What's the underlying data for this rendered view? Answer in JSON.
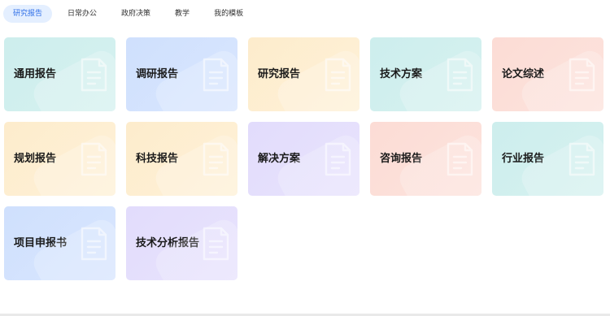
{
  "tabs": [
    {
      "label": "研究报告",
      "active": true
    },
    {
      "label": "日常办公",
      "active": false
    },
    {
      "label": "政府决策",
      "active": false
    },
    {
      "label": "教学",
      "active": false
    },
    {
      "label": "我的模板",
      "active": false
    }
  ],
  "cards": [
    {
      "title": "通用报告",
      "color": "teal"
    },
    {
      "title": "调研报告",
      "color": "blue"
    },
    {
      "title": "研究报告",
      "color": "cream"
    },
    {
      "title": "技术方案",
      "color": "teal"
    },
    {
      "title": "论文综述",
      "color": "pink"
    },
    {
      "title": "规划报告",
      "color": "cream"
    },
    {
      "title": "科技报告",
      "color": "cream"
    },
    {
      "title": "解决方案",
      "color": "purple"
    },
    {
      "title": "咨询报告",
      "color": "pink"
    },
    {
      "title": "行业报告",
      "color": "teal"
    },
    {
      "title": "项目申报书",
      "color": "blue"
    },
    {
      "title": "技术分析报告",
      "color": "purple"
    }
  ],
  "icons": {
    "card_icon": "document-icon"
  },
  "colors": {
    "accent": "#2f6fe8",
    "teal": "#cdeeed",
    "blue": "#cfe0fd",
    "cream": "#fdeccc",
    "pink": "#fcdcd5",
    "purple": "#e2dcfc"
  }
}
